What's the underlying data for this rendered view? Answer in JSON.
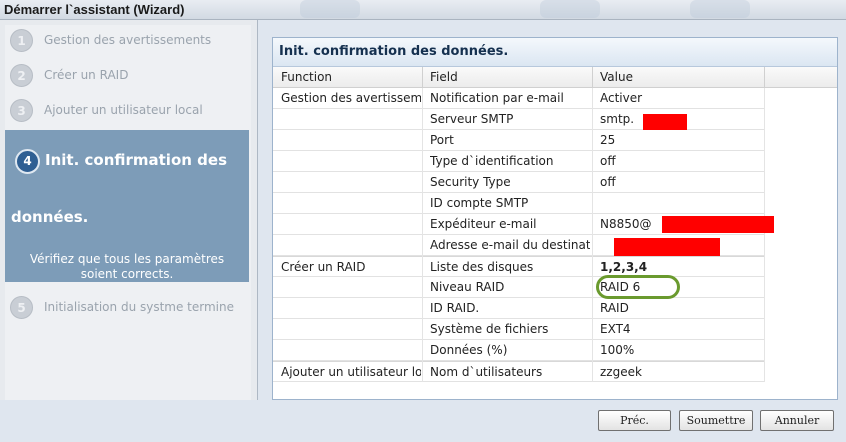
{
  "window": {
    "title": "Démarrer l`assistant (Wizard)"
  },
  "steps": [
    {
      "num": "1",
      "label": "Gestion des avertissements"
    },
    {
      "num": "2",
      "label": "Créer un RAID"
    },
    {
      "num": "3",
      "label": "Ajouter un utilisateur local"
    },
    {
      "num": "5",
      "label": "Initialisation du systme termine"
    }
  ],
  "active_step": {
    "num": "4",
    "title_line1": "Init. confirmation des",
    "title_line2": "données.",
    "description": "Vérifiez que tous les paramètres soient corrects."
  },
  "panel": {
    "title": "Init. confirmation des données.",
    "columns": [
      "Function",
      "Field",
      "Value"
    ],
    "rows": [
      {
        "function": "Gestion des avertissem...",
        "field": "Notification par e-mail",
        "value": "Activer"
      },
      {
        "function": "",
        "field": "Serveur SMTP",
        "value": "smtp."
      },
      {
        "function": "",
        "field": "Port",
        "value": "25"
      },
      {
        "function": "",
        "field": "Type d`identification",
        "value": "off"
      },
      {
        "function": "",
        "field": "Security Type",
        "value": "off"
      },
      {
        "function": "",
        "field": "ID compte SMTP",
        "value": ""
      },
      {
        "function": "",
        "field": "Expéditeur e-mail",
        "value": "N8850@"
      },
      {
        "function": "",
        "field": "Adresse e-mail du destinata...",
        "value": ""
      },
      {
        "function": "Créer un RAID",
        "field": "Liste des disques",
        "value": "1,2,3,4"
      },
      {
        "function": "",
        "field": "Niveau RAID",
        "value": "RAID 6"
      },
      {
        "function": "",
        "field": "ID RAID.",
        "value": "RAID"
      },
      {
        "function": "",
        "field": "Système de fichiers",
        "value": "EXT4"
      },
      {
        "function": "",
        "field": "Données (%)",
        "value": "100%"
      },
      {
        "function": "Ajouter un utilisateur lo...",
        "field": "Nom d`utilisateurs",
        "value": "zzgeek"
      }
    ]
  },
  "buttons": {
    "prev": "Préc.",
    "submit": "Soumettre",
    "cancel": "Annuler"
  },
  "colors": {
    "redaction": "#ff0000",
    "highlight": "#6a9a2e",
    "active_step_bg": "#7d9cb8"
  }
}
